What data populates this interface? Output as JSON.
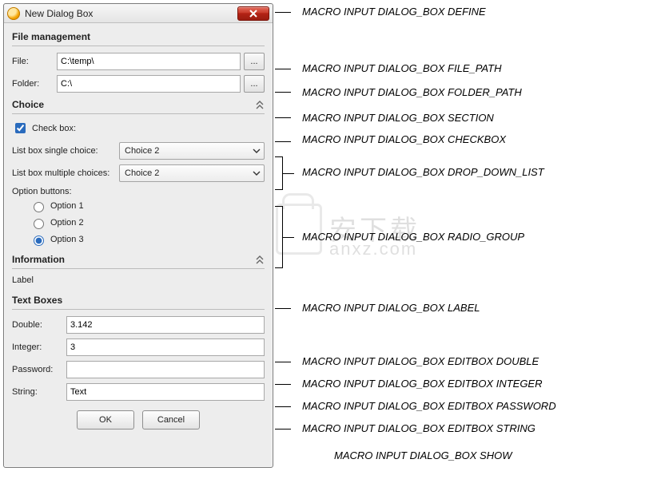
{
  "window": {
    "title": "New Dialog Box"
  },
  "sections": {
    "file_mgmt": "File management",
    "choice": "Choice",
    "information": "Information",
    "text_boxes": "Text Boxes"
  },
  "file": {
    "label": "File:",
    "value": "C:\\temp\\",
    "browse": "..."
  },
  "folder": {
    "label": "Folder:",
    "value": "C:\\",
    "browse": "..."
  },
  "checkbox": {
    "label": "Check box:",
    "checked": true
  },
  "listbox_single": {
    "label": "List box single choice:",
    "value": "Choice 2"
  },
  "listbox_multi": {
    "label": "List box multiple choices:",
    "value": "Choice 2"
  },
  "option_group": {
    "heading": "Option buttons:",
    "options": [
      "Option 1",
      "Option 2",
      "Option 3"
    ],
    "selected_index": 2
  },
  "info_label": "Label",
  "textboxes": {
    "double": {
      "label": "Double:",
      "value": "3.142"
    },
    "integer": {
      "label": "Integer:",
      "value": "3"
    },
    "password": {
      "label": "Password:",
      "value": ""
    },
    "string": {
      "label": "String:",
      "value": "Text"
    }
  },
  "buttons": {
    "ok": "OK",
    "cancel": "Cancel"
  },
  "annotations": {
    "define": "MACRO INPUT DIALOG_BOX DEFINE",
    "file_path": "MACRO INPUT DIALOG_BOX FILE_PATH",
    "folder_path": "MACRO INPUT DIALOG_BOX FOLDER_PATH",
    "section": "MACRO INPUT DIALOG_BOX SECTION",
    "checkbox": "MACRO INPUT DIALOG_BOX CHECKBOX",
    "dropdown": "MACRO INPUT DIALOG_BOX DROP_DOWN_LIST",
    "radio_group": "MACRO INPUT DIALOG_BOX RADIO_GROUP",
    "label": "MACRO INPUT DIALOG_BOX LABEL",
    "editbox_double": "MACRO INPUT DIALOG_BOX EDITBOX DOUBLE",
    "editbox_integer": "MACRO INPUT DIALOG_BOX EDITBOX INTEGER",
    "editbox_password": "MACRO INPUT DIALOG_BOX EDITBOX PASSWORD",
    "editbox_string": "MACRO INPUT DIALOG_BOX EDITBOX STRING",
    "show": "MACRO INPUT DIALOG_BOX SHOW"
  },
  "watermark": {
    "line1": "安下载",
    "line2": "anxz.com"
  }
}
